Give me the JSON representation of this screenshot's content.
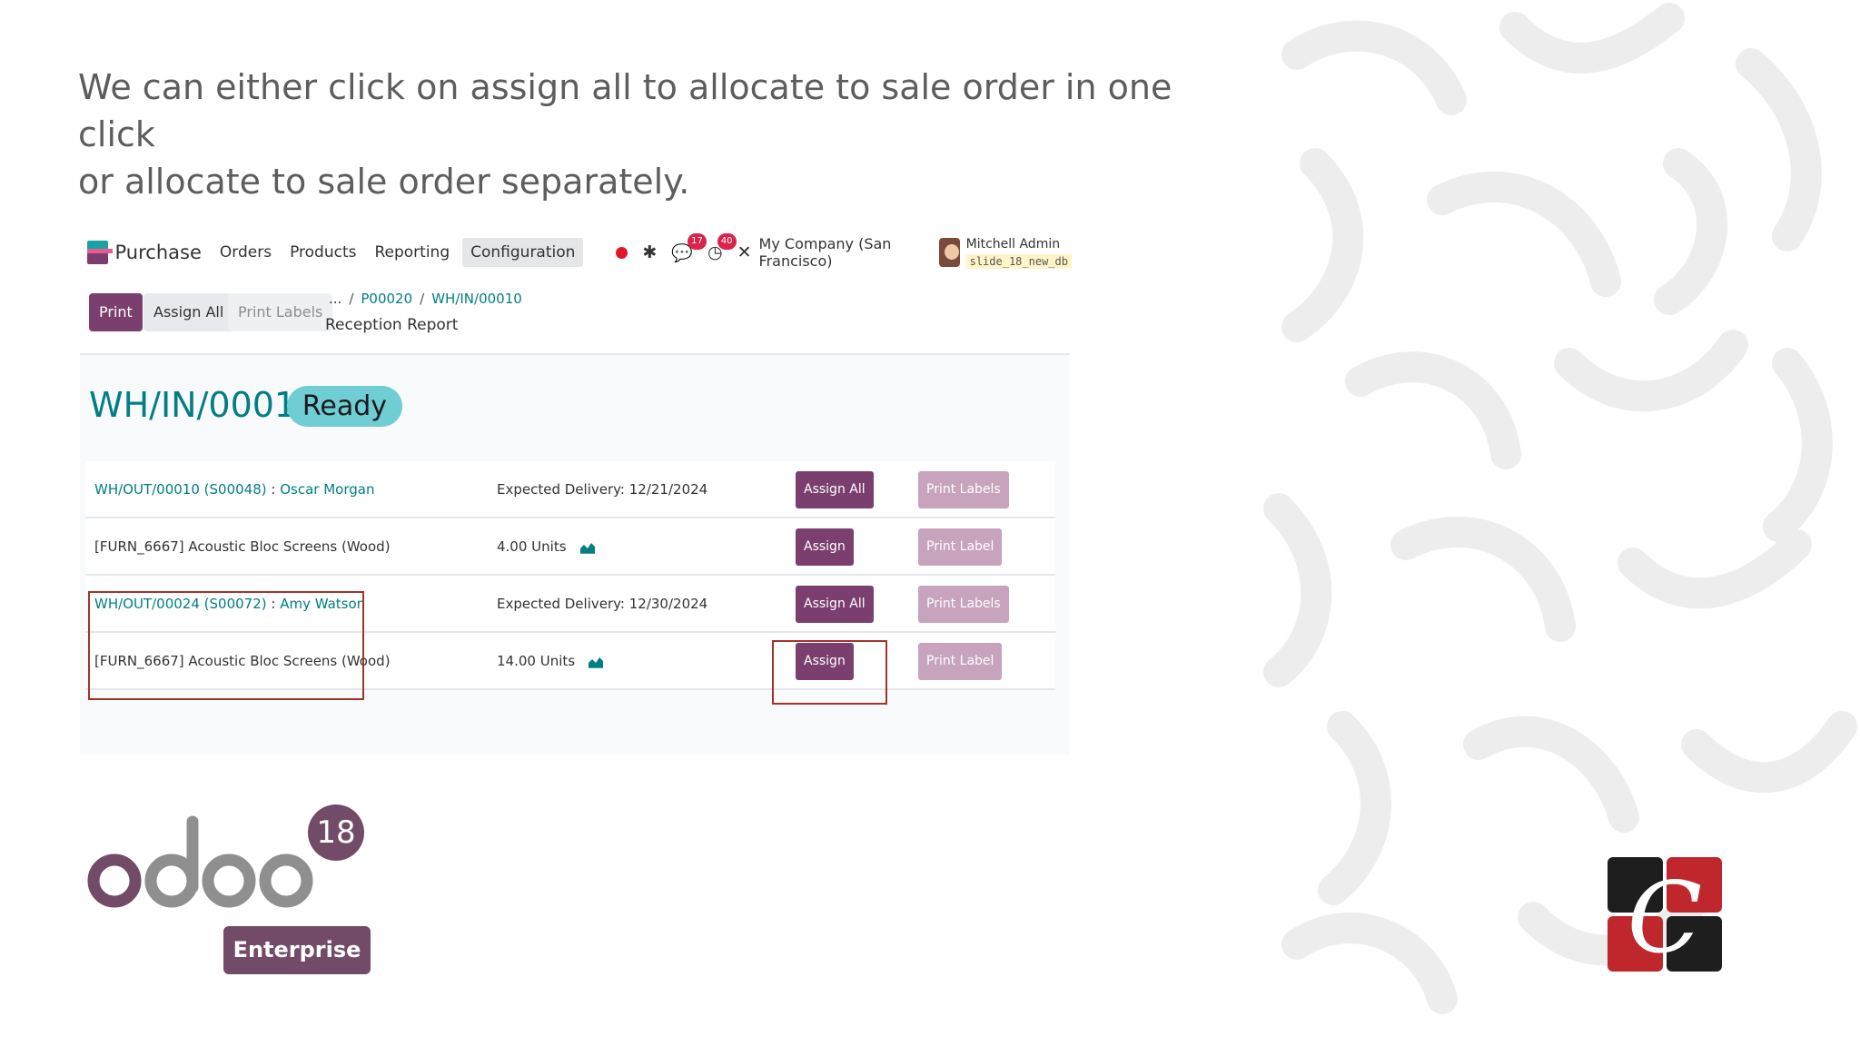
{
  "slide": {
    "caption_line1": "We can either click on assign all to allocate to sale order in one click",
    "caption_line2": "or allocate to sale order separately."
  },
  "navbar": {
    "app_name": "Purchase",
    "menus": [
      "Orders",
      "Products",
      "Reporting",
      "Configuration"
    ],
    "active_menu": "Configuration",
    "messages_badge": "17",
    "activities_badge": "40",
    "company": "My Company (San Francisco)",
    "user_name": "Mitchell Admin",
    "database": "slide_18_new_db"
  },
  "control_panel": {
    "print_label": "Print",
    "assign_all_label": "Assign All",
    "print_labels_label": "Print Labels",
    "breadcrumb_ellipsis": "...",
    "breadcrumb": [
      "P00020",
      "WH/IN/00010"
    ],
    "subtitle": "Reception Report"
  },
  "report": {
    "title": "WH/IN/00010",
    "status": "Ready",
    "groups": [
      {
        "move_ref": "WH/OUT/00010",
        "order_ref": "(S00048)",
        "customer_sep": " : ",
        "customer": "Oscar Morgan",
        "expected_delivery": "Expected Delivery: 12/21/2024",
        "assign_all_label": "Assign All",
        "print_labels_label": "Print Labels",
        "product": "[FURN_6667] Acoustic Bloc Screens (Wood)",
        "quantity": "4.00 Units",
        "assign_label": "Assign",
        "print_label_label": "Print Label"
      },
      {
        "move_ref": "WH/OUT/00024",
        "order_ref": "(S00072)",
        "customer_sep": " : ",
        "customer": "Amy Watson",
        "expected_delivery": "Expected Delivery: 12/30/2024",
        "assign_all_label": "Assign All",
        "print_labels_label": "Print Labels",
        "product": "[FURN_6667] Acoustic Bloc Screens (Wood)",
        "quantity": "14.00 Units",
        "assign_label": "Assign",
        "print_label_label": "Print Label"
      }
    ]
  },
  "branding": {
    "odoo_wordmark": "odoo",
    "odoo_version": "18",
    "odoo_edition": "Enterprise",
    "company_logo_letter": "C",
    "colors": {
      "odoo_purple": "#714b67",
      "odoo_grey": "#8f8f8f",
      "company_red": "#c0272d",
      "company_black": "#1e1e1e"
    }
  },
  "colors": {
    "primary_button": "#7b3f6f",
    "link": "#017e84",
    "status_ready": "#70cdd4",
    "highlight_border": "#a3322a"
  }
}
